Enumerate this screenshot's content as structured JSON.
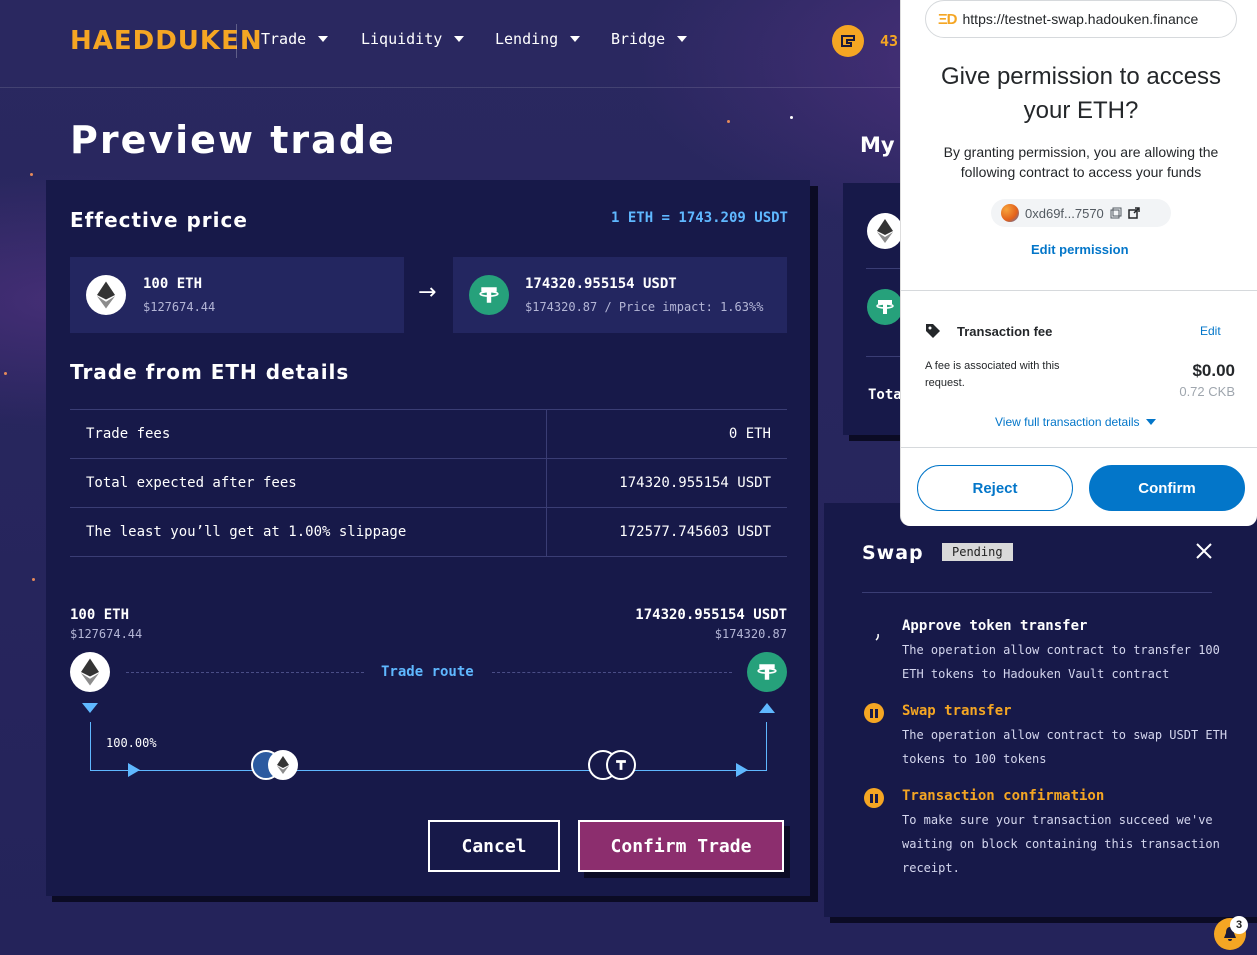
{
  "colors": {
    "background": "#26245a",
    "card": "#171949",
    "accent_blue": "#5fb8ff",
    "brand_orange": "#f5a623",
    "confirm_pink": "#8c2e6e",
    "metamask_blue": "#0376c9"
  },
  "nav": {
    "logo": "HAEDDUKEN",
    "items": [
      {
        "label": "Trade"
      },
      {
        "label": "Liquidity"
      },
      {
        "label": "Lending"
      },
      {
        "label": "Bridge"
      }
    ],
    "balance_partial": "43"
  },
  "page": {
    "title": "Preview trade",
    "side_title_partial": "My"
  },
  "effective_price": {
    "title": "Effective price",
    "rate": "1 ETH = 1743.209 USDT",
    "from": {
      "amount": "100 ETH",
      "usd": "$127674.44",
      "icon": "eth-icon"
    },
    "to": {
      "amount": "174320.955154 USDT",
      "usd_and_impact": "$174320.87 / Price impact: 1.63%%",
      "icon": "usdt-icon"
    }
  },
  "details": {
    "title": "Trade from ETH details",
    "rows": [
      {
        "label": "Trade fees",
        "value": "0 ETH"
      },
      {
        "label": "Total expected after fees",
        "value": "174320.955154 USDT"
      },
      {
        "label": "The least you’ll get at 1.00% slippage",
        "value": "172577.745603 USDT"
      }
    ]
  },
  "route": {
    "from_amount": "100 ETH",
    "from_usd": "$127674.44",
    "to_amount": "174320.955154 USDT",
    "to_usd": "$174320.87",
    "label": "Trade route",
    "percent": "100.00%"
  },
  "buttons": {
    "cancel": "Cancel",
    "confirm": "Confirm Trade"
  },
  "side_panel": {
    "total_partial": "Tota"
  },
  "swap_panel": {
    "title": "Swap",
    "status": "Pending",
    "steps": [
      {
        "title": "Approve token transfer",
        "desc": "The operation allow contract to transfer 100 ETH tokens to Hadouken Vault contract",
        "state": "loading"
      },
      {
        "title": "Swap transfer",
        "desc": "The operation allow contract to swap USDT ETH tokens to 100 tokens",
        "state": "paused"
      },
      {
        "title": "Transaction confirmation",
        "desc": "To make sure your transaction succeed we've waiting on block containing this transaction receipt.",
        "state": "paused"
      }
    ]
  },
  "wallet": {
    "url": "https://testnet-swap.hadouken.finance",
    "title": "Give permission to access your ETH?",
    "description": "By granting permission, you are allowing the following contract to access your funds",
    "address": "0xd69f...7570",
    "edit_permission": "Edit permission",
    "fee_title": "Transaction fee",
    "fee_edit": "Edit",
    "fee_desc": "A fee is associated with this request.",
    "fee_usd": "$0.00",
    "fee_ckb": "0.72 CKB",
    "view_details": "View full transaction details",
    "reject": "Reject",
    "confirm": "Confirm"
  },
  "notifications": {
    "count": "3"
  }
}
